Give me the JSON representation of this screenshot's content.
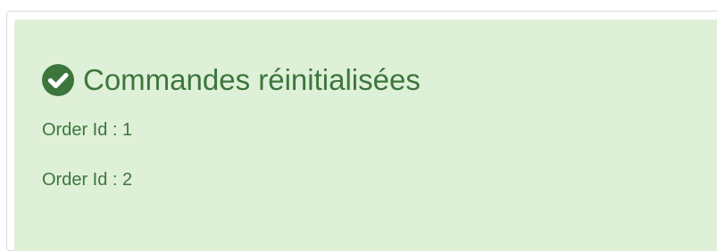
{
  "alert": {
    "icon": "check-circle-icon",
    "title": "Commandes réinitialisées",
    "color": "#3c763d",
    "background": "#dff0d8",
    "orders": [
      {
        "label": "Order Id : 1"
      },
      {
        "label": "Order Id : 2"
      }
    ]
  }
}
